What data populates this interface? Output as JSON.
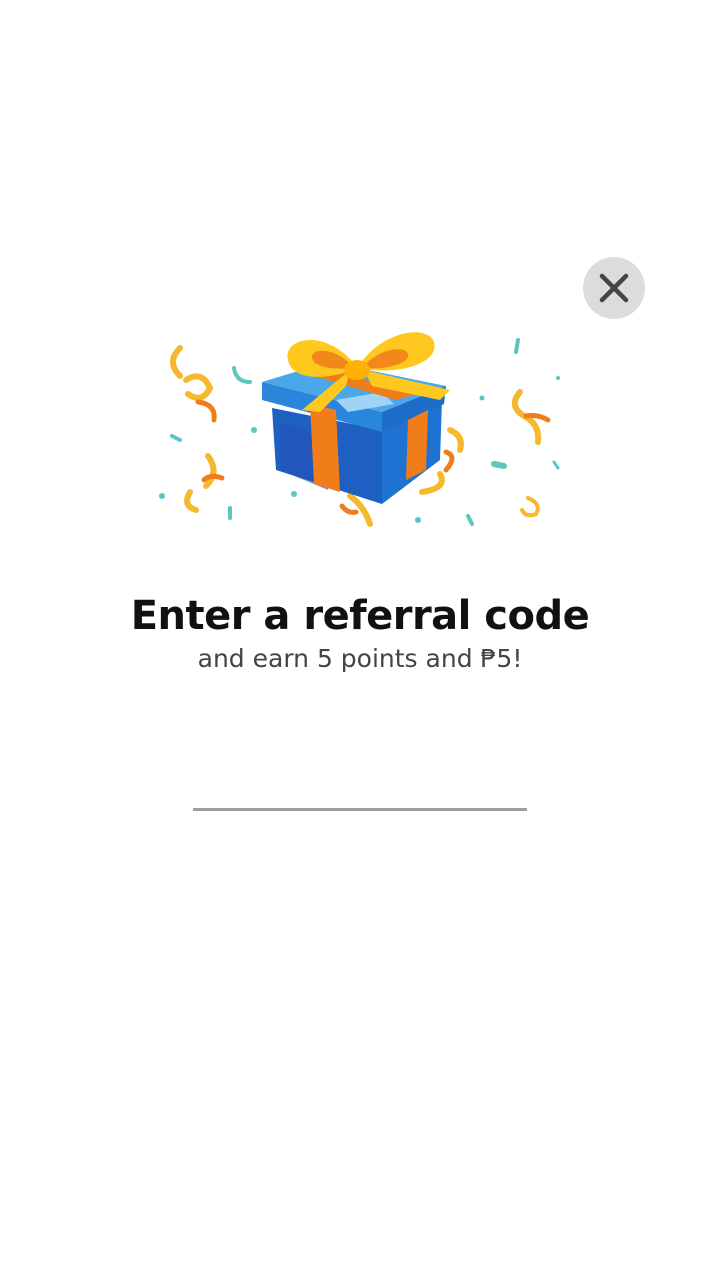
{
  "dialog": {
    "title": "Enter a referral code",
    "subtitle": "and earn 5 points and ₱5!",
    "close_icon": "close-icon",
    "illustration_icon": "gift-box-confetti-icon"
  },
  "referral_input": {
    "value": "",
    "placeholder": ""
  },
  "colors": {
    "background": "#ffffff",
    "close_button_bg": "#dcdcdc",
    "close_icon": "#444444",
    "title": "#111111",
    "subtitle": "#444444",
    "input_underline": "#9e9e9e",
    "gift_blue": "#1e73d2",
    "gift_ribbon_orange": "#f07d1a",
    "bow_yellow": "#ffc81e",
    "confetti_teal": "#5cc6c0",
    "confetti_yellow": "#f5b82e"
  }
}
